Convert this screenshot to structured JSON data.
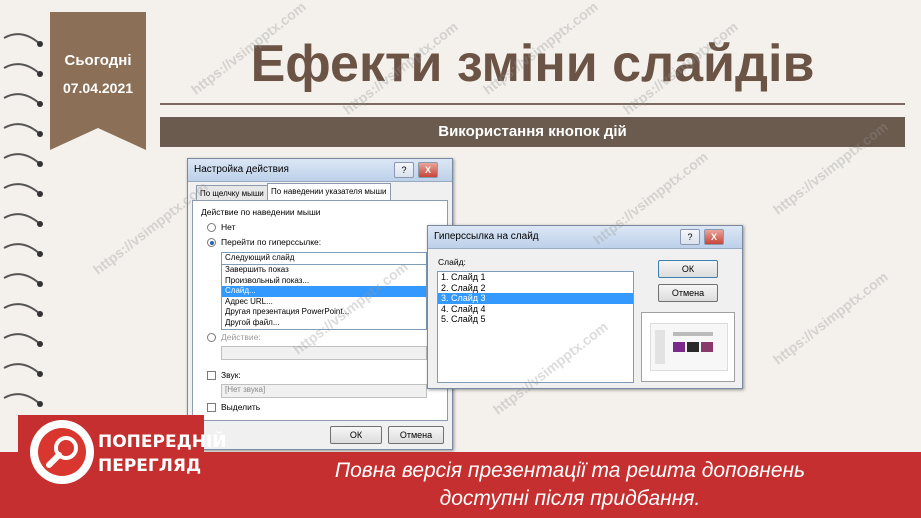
{
  "slide": {
    "date_label": "Сьогодні",
    "date_value": "07.04.2021",
    "title": "Ефекти зміни слайдів",
    "subtitle": "Використання кнопок дій"
  },
  "action_dialog": {
    "title": "Настройка действия",
    "help": "?",
    "close": "X",
    "tabs": [
      "По щелчку мыши",
      "По наведении указателя мыши"
    ],
    "group_label": "Действие по наведении мыши",
    "option_none": "Нет",
    "option_hyperlink": "Перейти по гиперссылке:",
    "hyperlink_value": "Следующий слайд",
    "hyperlink_options": [
      "Завершить показ",
      "Произвольный показ...",
      "Слайд...",
      "Адрес URL...",
      "Другая презентация PowerPoint...",
      "Другой файл..."
    ],
    "option_action": "Действие:",
    "sound_label": "Звук:",
    "sound_value": "[Нет звука]",
    "highlight_label": "Выделить",
    "ok": "ОК",
    "cancel": "Отмена"
  },
  "slide_dialog": {
    "title": "Гиперссылка на слайд",
    "help": "?",
    "close": "X",
    "list_label": "Слайд:",
    "slides": [
      "1. Слайд 1",
      "2. Слайд 2",
      "3. Слайд 3",
      "4. Слайд 4",
      "5. Слайд 5"
    ],
    "selected_index": 2,
    "ok": "ОК",
    "cancel": "Отмена"
  },
  "preview_banner": {
    "badge_line1": "ПОПЕРЕДНІЙ",
    "badge_line2": "ПЕРЕГЛЯД",
    "text_line1": "Повна версія презентації та решта доповнень",
    "text_line2": "доступні після придбання."
  },
  "watermark": "https://vsimpptx.com",
  "colors": {
    "brown": "#6b5446",
    "tag": "#8b6f57",
    "banner_red": "#c62f2f",
    "selection_blue": "#3399ff"
  }
}
